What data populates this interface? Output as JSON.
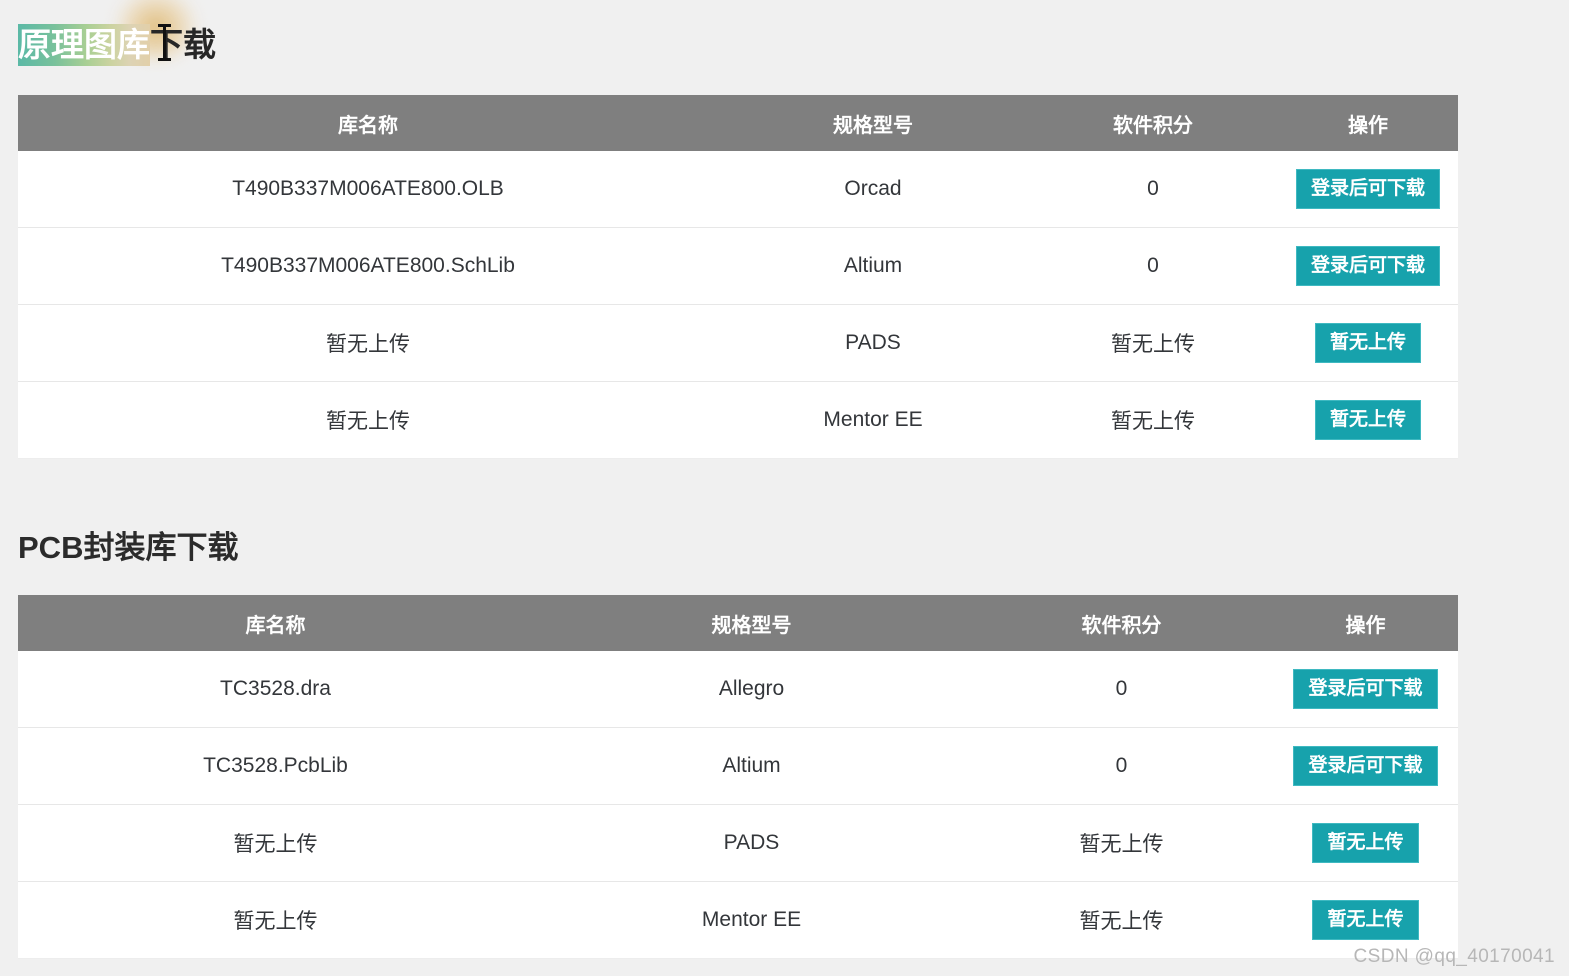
{
  "page": {
    "background_color": "#f0f0f0",
    "watermark": "CSDN @qq_40170041"
  },
  "theme": {
    "header_bg": "#7f7f7f",
    "button_bg": "#17a2ac",
    "button_border": "#3fb9c1",
    "row_divider": "#e7e7e7",
    "text_color": "#35383c"
  },
  "sections": [
    {
      "heading_selected": "原理图库",
      "heading_rest": "下载",
      "heading_full": "原理图库下载",
      "columns": [
        "库名称",
        "规格型号",
        "软件积分",
        "操作"
      ],
      "rows": [
        {
          "name": "T490B337M006ATE800.OLB",
          "spec": "Orcad",
          "points": "0",
          "action": "登录后可下载"
        },
        {
          "name": "T490B337M006ATE800.SchLib",
          "spec": "Altium",
          "points": "0",
          "action": "登录后可下载"
        },
        {
          "name": "暂无上传",
          "spec": "PADS",
          "points": "暂无上传",
          "action": "暂无上传"
        },
        {
          "name": "暂无上传",
          "spec": "Mentor EE",
          "points": "暂无上传",
          "action": "暂无上传"
        }
      ]
    },
    {
      "heading_full": "PCB封装库下载",
      "columns": [
        "库名称",
        "规格型号",
        "软件积分",
        "操作"
      ],
      "rows": [
        {
          "name": "TC3528.dra",
          "spec": "Allegro",
          "points": "0",
          "action": "登录后可下载"
        },
        {
          "name": "TC3528.PcbLib",
          "spec": "Altium",
          "points": "0",
          "action": "登录后可下载"
        },
        {
          "name": "暂无上传",
          "spec": "PADS",
          "points": "暂无上传",
          "action": "暂无上传"
        },
        {
          "name": "暂无上传",
          "spec": "Mentor EE",
          "points": "暂无上传",
          "action": "暂无上传"
        }
      ]
    }
  ]
}
